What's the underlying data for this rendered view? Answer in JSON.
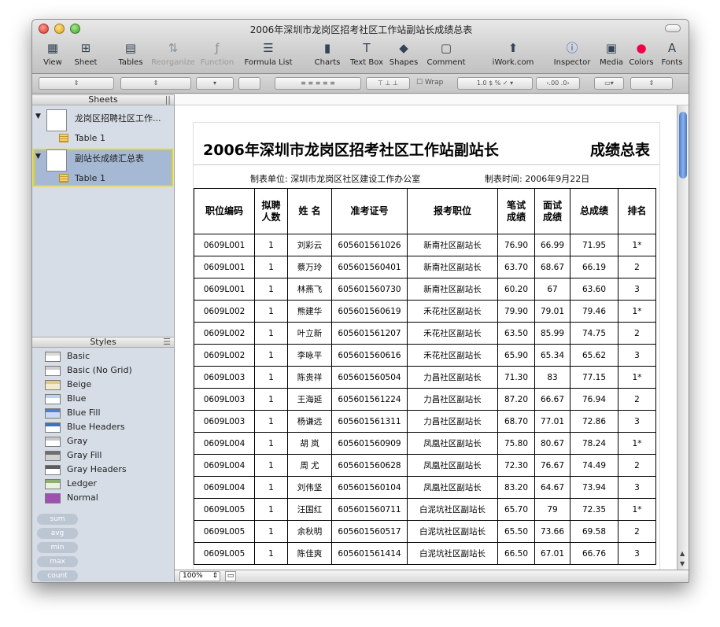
{
  "window": {
    "title": "2006年深圳市龙岗区招考社区工作站副站长成绩总表"
  },
  "toolbar": {
    "items": [
      {
        "label": "View",
        "icon": "view-icon",
        "enabled": true
      },
      {
        "label": "Sheet",
        "icon": "sheet-icon",
        "enabled": true
      },
      {
        "label": "Tables",
        "icon": "tables-icon",
        "enabled": true
      },
      {
        "label": "Reorganize",
        "icon": "reorganize-icon",
        "enabled": false
      },
      {
        "label": "Function",
        "icon": "function-icon",
        "enabled": false
      },
      {
        "label": "Formula List",
        "icon": "formula-list-icon",
        "enabled": true
      },
      {
        "label": "Charts",
        "icon": "charts-icon",
        "enabled": true
      },
      {
        "label": "Text Box",
        "icon": "text-box-icon",
        "enabled": true
      },
      {
        "label": "Shapes",
        "icon": "shapes-icon",
        "enabled": true
      },
      {
        "label": "Comment",
        "icon": "comment-icon",
        "enabled": true
      },
      {
        "label": "iWork.com",
        "icon": "iwork-icon",
        "enabled": true
      },
      {
        "label": "Inspector",
        "icon": "inspector-icon",
        "enabled": true
      },
      {
        "label": "Media",
        "icon": "media-icon",
        "enabled": true
      },
      {
        "label": "Colors",
        "icon": "colors-icon",
        "enabled": true
      },
      {
        "label": "Fonts",
        "icon": "fonts-icon",
        "enabled": true
      }
    ]
  },
  "format_bar": {
    "wrap_label": "Wrap",
    "decimal_labels": [
      "0.0",
      "$",
      "%",
      "✓"
    ],
    "inc_decimal": ".00",
    "dec_decimal": ".0"
  },
  "sidebar": {
    "sheets_header": "Sheets",
    "sheets": [
      {
        "name": "龙岗区招聘社区工作...",
        "table": "Table 1",
        "selected": false
      },
      {
        "name": "副站长成绩汇总表",
        "table": "Table 1",
        "selected": true
      }
    ],
    "styles_header": "Styles",
    "styles": [
      {
        "name": "Basic",
        "swatch": "#ffffff",
        "head": "#d9d9d9"
      },
      {
        "name": "Basic (No Grid)",
        "swatch": "#ffffff",
        "head": "#cfcfcf"
      },
      {
        "name": "Beige",
        "swatch": "#f4ead0",
        "head": "#e0c98e"
      },
      {
        "name": "Blue",
        "swatch": "#ffffff",
        "head": "#bcd2ee"
      },
      {
        "name": "Blue Fill",
        "swatch": "#c9dbf4",
        "head": "#4f7fcc"
      },
      {
        "name": "Blue Headers",
        "swatch": "#ffffff",
        "head": "#3f6fbf"
      },
      {
        "name": "Gray",
        "swatch": "#ffffff",
        "head": "#c8c8c8"
      },
      {
        "name": "Gray Fill",
        "swatch": "#d2d2d2",
        "head": "#6e6e6e"
      },
      {
        "name": "Gray Headers",
        "swatch": "#ffffff",
        "head": "#5c5c5c"
      },
      {
        "name": "Ledger",
        "swatch": "#e9f1e0",
        "head": "#8fb070"
      },
      {
        "name": "Normal",
        "swatch": "#a050b0",
        "head": "#a050b0"
      }
    ],
    "functions": [
      "sum",
      "avg",
      "min",
      "max",
      "count"
    ]
  },
  "canvas": {
    "zoom": "100%"
  },
  "document": {
    "title": "2006年深圳市龙岗区招考社区工作站副站长",
    "title_right": "成绩总表",
    "unit": "制表单位:  深圳市龙岗区社区建设工作办公室",
    "date": "制表时间:  2006年9月22日",
    "headers": [
      "职位编码",
      "拟聘\n人数",
      "姓  名",
      "准考证号",
      "报考职位",
      "笔试\n成绩",
      "面试\n成绩",
      "总成绩",
      "排名"
    ],
    "rows": [
      [
        "0609L001",
        "1",
        "刘彩云",
        "605601561026",
        "新南社区副站长",
        "76.90",
        "66.99",
        "71.95",
        "1*"
      ],
      [
        "0609L001",
        "1",
        "蔡万玲",
        "605601560401",
        "新南社区副站长",
        "63.70",
        "68.67",
        "66.19",
        "2"
      ],
      [
        "0609L001",
        "1",
        "林燕飞",
        "605601560730",
        "新南社区副站长",
        "60.20",
        "67",
        "63.60",
        "3"
      ],
      [
        "0609L002",
        "1",
        "熊建华",
        "605601560619",
        "禾花社区副站长",
        "79.90",
        "79.01",
        "79.46",
        "1*"
      ],
      [
        "0609L002",
        "1",
        "叶立新",
        "605601561207",
        "禾花社区副站长",
        "63.50",
        "85.99",
        "74.75",
        "2"
      ],
      [
        "0609L002",
        "1",
        "李咏平",
        "605601560616",
        "禾花社区副站长",
        "65.90",
        "65.34",
        "65.62",
        "3"
      ],
      [
        "0609L003",
        "1",
        "陈贵祥",
        "605601560504",
        "力昌社区副站长",
        "71.30",
        "83",
        "77.15",
        "1*"
      ],
      [
        "0609L003",
        "1",
        "王海延",
        "605601561224",
        "力昌社区副站长",
        "87.20",
        "66.67",
        "76.94",
        "2"
      ],
      [
        "0609L003",
        "1",
        "杨谦远",
        "605601561311",
        "力昌社区副站长",
        "68.70",
        "77.01",
        "72.86",
        "3"
      ],
      [
        "0609L004",
        "1",
        "胡  岚",
        "605601560909",
        "凤凰社区副站长",
        "75.80",
        "80.67",
        "78.24",
        "1*"
      ],
      [
        "0609L004",
        "1",
        "周  尤",
        "605601560628",
        "凤凰社区副站长",
        "72.30",
        "76.67",
        "74.49",
        "2"
      ],
      [
        "0609L004",
        "1",
        "刘伟坚",
        "605601560104",
        "凤凰社区副站长",
        "83.20",
        "64.67",
        "73.94",
        "3"
      ],
      [
        "0609L005",
        "1",
        "汪国红",
        "605601560711",
        "白泥坑社区副站长",
        "65.70",
        "79",
        "72.35",
        "1*"
      ],
      [
        "0609L005",
        "1",
        "余秋明",
        "605601560517",
        "白泥坑社区副站长",
        "65.50",
        "73.66",
        "69.58",
        "2"
      ],
      [
        "0609L005",
        "1",
        "陈佳爽",
        "605601561414",
        "白泥坑社区副站长",
        "66.50",
        "67.01",
        "66.76",
        "3"
      ]
    ]
  }
}
